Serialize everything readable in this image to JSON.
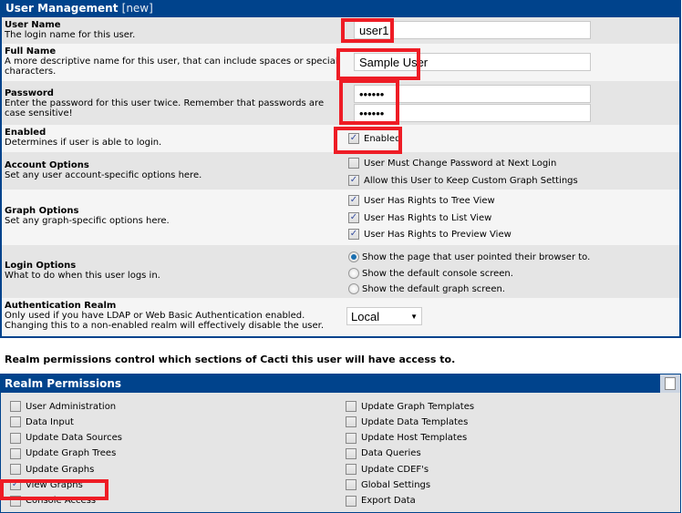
{
  "user_management": {
    "title": "User Management",
    "title_suffix": "[new]",
    "user_name": {
      "label": "User Name",
      "desc": "The login name for this user.",
      "value": "user1"
    },
    "full_name": {
      "label": "Full Name",
      "desc": "A more descriptive name for this user, that can include spaces or special characters.",
      "value": "Sample User"
    },
    "password": {
      "label": "Password",
      "desc": "Enter the password for this user twice. Remember that passwords are case sensitive!",
      "value": "••••••",
      "confirm": "••••••"
    },
    "enabled": {
      "label": "Enabled",
      "desc": "Determines if user is able to login.",
      "option": "Enabled",
      "checked": true
    },
    "account_options": {
      "label": "Account Options",
      "desc": "Set any user account-specific options here.",
      "options": [
        {
          "label": "User Must Change Password at Next Login",
          "checked": false
        },
        {
          "label": "Allow this User to Keep Custom Graph Settings",
          "checked": true
        }
      ]
    },
    "graph_options": {
      "label": "Graph Options",
      "desc": "Set any graph-specific options here.",
      "options": [
        {
          "label": "User Has Rights to Tree View",
          "checked": true
        },
        {
          "label": "User Has Rights to List View",
          "checked": true
        },
        {
          "label": "User Has Rights to Preview View",
          "checked": true
        }
      ]
    },
    "login_options": {
      "label": "Login Options",
      "desc": "What to do when this user logs in.",
      "options": [
        {
          "label": "Show the page that user pointed their browser to.",
          "selected": true
        },
        {
          "label": "Show the default console screen.",
          "selected": false
        },
        {
          "label": "Show the default graph screen.",
          "selected": false
        }
      ]
    },
    "auth_realm": {
      "label": "Authentication Realm",
      "desc": "Only used if you have LDAP or Web Basic Authentication enabled. Changing this to a non-enabled realm will effectively disable the user.",
      "value": "Local"
    }
  },
  "realm_note": "Realm permissions control which sections of Cacti this user will have access to.",
  "realm_permissions": {
    "title": "Realm Permissions",
    "left": [
      {
        "label": "User Administration",
        "checked": false
      },
      {
        "label": "Data Input",
        "checked": false
      },
      {
        "label": "Update Data Sources",
        "checked": false
      },
      {
        "label": "Update Graph Trees",
        "checked": false
      },
      {
        "label": "Update Graphs",
        "checked": false
      },
      {
        "label": "View Graphs",
        "checked": true
      },
      {
        "label": "Console Access",
        "checked": false
      }
    ],
    "right": [
      {
        "label": "Update Graph Templates",
        "checked": false
      },
      {
        "label": "Update Data Templates",
        "checked": false
      },
      {
        "label": "Update Host Templates",
        "checked": false
      },
      {
        "label": "Data Queries",
        "checked": false
      },
      {
        "label": "Update CDEF's",
        "checked": false
      },
      {
        "label": "Global Settings",
        "checked": false
      },
      {
        "label": "Export Data",
        "checked": false
      }
    ]
  },
  "colors": {
    "header": "#00438c",
    "highlight": "#ee1c25"
  }
}
